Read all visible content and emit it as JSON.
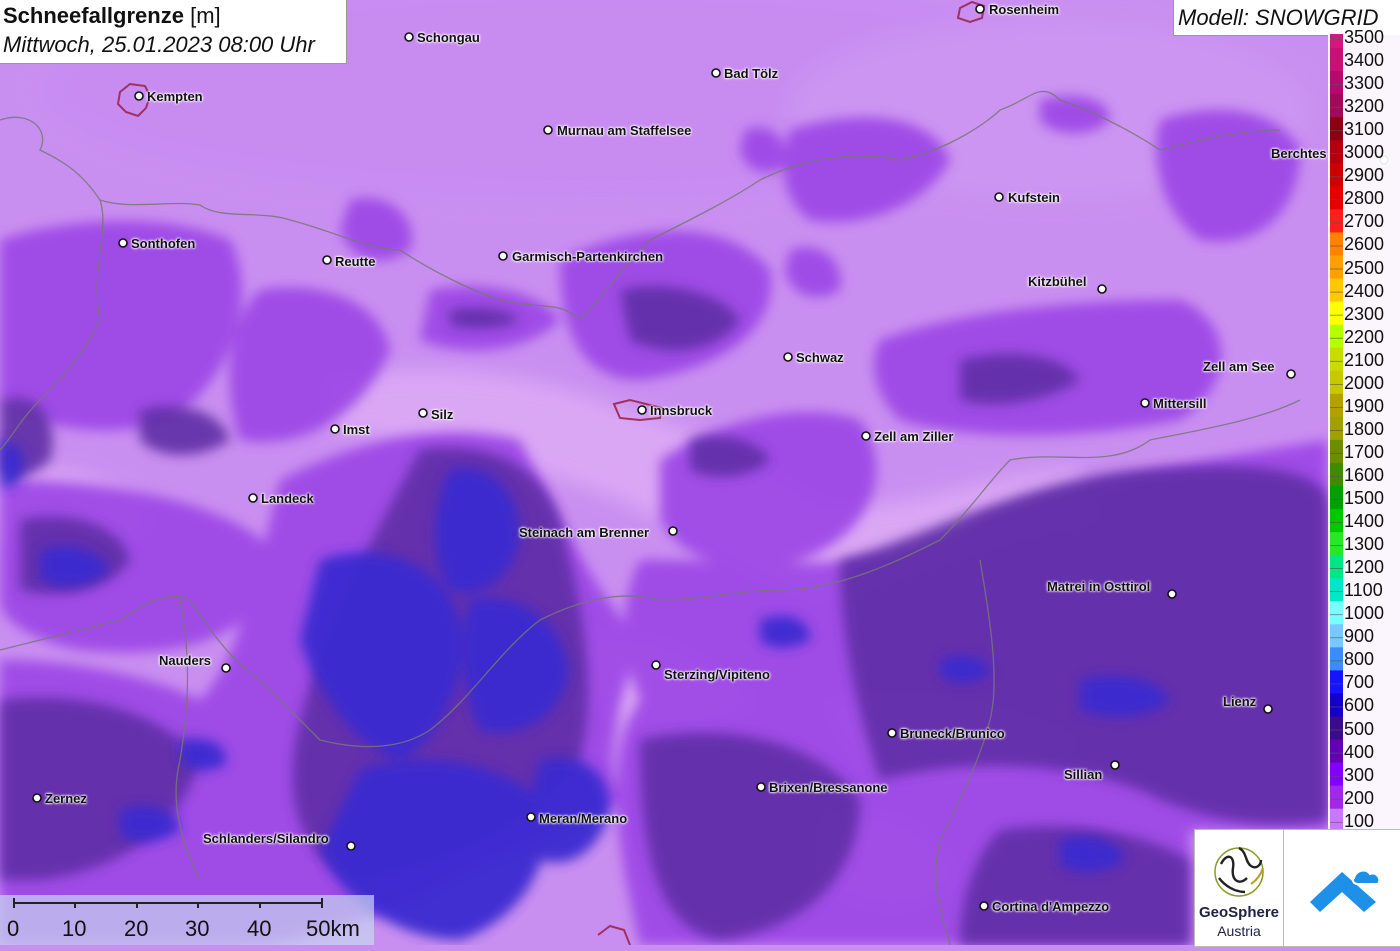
{
  "title": {
    "main": "Schneefallgrenze",
    "unit": "[m]",
    "subtitle": "Mittwoch, 25.01.2023 08:00 Uhr"
  },
  "model": "Modell: SNOWGRID",
  "legend": {
    "levels": [
      {
        "label": "3500",
        "color": "#d21782"
      },
      {
        "label": "3400",
        "color": "#c81077"
      },
      {
        "label": "3300",
        "color": "#b40a6e"
      },
      {
        "label": "3200",
        "color": "#a00a5a"
      },
      {
        "label": "3100",
        "color": "#8c0014"
      },
      {
        "label": "3000",
        "color": "#b4000a"
      },
      {
        "label": "2900",
        "color": "#cd0000"
      },
      {
        "label": "2800",
        "color": "#e60000"
      },
      {
        "label": "2700",
        "color": "#ff1e1e"
      },
      {
        "label": "2600",
        "color": "#ff8200"
      },
      {
        "label": "2500",
        "color": "#ffa000"
      },
      {
        "label": "2400",
        "color": "#ffc800"
      },
      {
        "label": "2300",
        "color": "#ffff00"
      },
      {
        "label": "2200",
        "color": "#b4ff00"
      },
      {
        "label": "2100",
        "color": "#c8dc00"
      },
      {
        "label": "2000",
        "color": "#c8c800"
      },
      {
        "label": "1900",
        "color": "#b4a000"
      },
      {
        "label": "1800",
        "color": "#a0a000"
      },
      {
        "label": "1700",
        "color": "#6e8c00"
      },
      {
        "label": "1600",
        "color": "#3c8c00"
      },
      {
        "label": "1500",
        "color": "#00a000"
      },
      {
        "label": "1400",
        "color": "#00c800"
      },
      {
        "label": "1300",
        "color": "#28e628"
      },
      {
        "label": "1200",
        "color": "#00e687"
      },
      {
        "label": "1100",
        "color": "#00e6c8"
      },
      {
        "label": "1000",
        "color": "#78ffff"
      },
      {
        "label": "900",
        "color": "#78c8ff"
      },
      {
        "label": "800",
        "color": "#3c8cff"
      },
      {
        "label": "700",
        "color": "#1414ff"
      },
      {
        "label": "600",
        "color": "#1400c8"
      },
      {
        "label": "500",
        "color": "#3c0a8c"
      },
      {
        "label": "400",
        "color": "#6400b4"
      },
      {
        "label": "300",
        "color": "#8200ff"
      },
      {
        "label": "200",
        "color": "#a028e6"
      },
      {
        "label": "100",
        "color": "#c878ff"
      }
    ]
  },
  "cities": [
    {
      "name": "Schongau",
      "side": "right"
    },
    {
      "name": "Rosenheim",
      "side": "right"
    },
    {
      "name": "Kempten",
      "side": "right"
    },
    {
      "name": "Bad Tölz",
      "side": "right"
    },
    {
      "name": "Murnau am Staffelsee",
      "side": "right"
    },
    {
      "name": "Berchtes",
      "side": "left"
    },
    {
      "name": "Kufstein",
      "side": "right"
    },
    {
      "name": "Sonthofen",
      "side": "right"
    },
    {
      "name": "Reutte",
      "side": "right"
    },
    {
      "name": "Garmisch-Partenkirchen",
      "side": "right"
    },
    {
      "name": "Kitzbühel",
      "side": "left"
    },
    {
      "name": "Schwaz",
      "side": "right"
    },
    {
      "name": "Zell am See",
      "side": "left"
    },
    {
      "name": "Mittersill",
      "side": "right"
    },
    {
      "name": "Innsbruck",
      "side": "right"
    },
    {
      "name": "Silz",
      "side": "right"
    },
    {
      "name": "Imst",
      "side": "right"
    },
    {
      "name": "Zell am Ziller",
      "side": "right"
    },
    {
      "name": "Landeck",
      "side": "right"
    },
    {
      "name": "Steinach am Brenner",
      "side": "left"
    },
    {
      "name": "Matrei in Osttirol",
      "side": "left"
    },
    {
      "name": "Nauders",
      "side": "left"
    },
    {
      "name": "Sterzing/Vipiteno",
      "side": "right"
    },
    {
      "name": "Lienz",
      "side": "left"
    },
    {
      "name": "Bruneck/Brunico",
      "side": "right"
    },
    {
      "name": "Sillian",
      "side": "left"
    },
    {
      "name": "Brixen/Bressanone",
      "side": "right"
    },
    {
      "name": "Zernez",
      "side": "right"
    },
    {
      "name": "Meran/Merano",
      "side": "right"
    },
    {
      "name": "Schlanders/Silandro",
      "side": "left"
    },
    {
      "name": "Cortina d'Ampezzo",
      "side": "right"
    }
  ],
  "scalebar": {
    "ticks": [
      "0",
      "10",
      "20",
      "30",
      "40",
      "50km"
    ]
  },
  "logos": {
    "geosphere_name": "GeoSphere",
    "geosphere_sub": "Austria"
  },
  "colors": {
    "lowland": "#c98ff0",
    "valley_light": "#d9a6f4",
    "mid": "#9a3fe6",
    "dark": "#5a2aa0",
    "blue": "#3a2ad0",
    "border": "#777777",
    "city_outline": "#a03060"
  }
}
